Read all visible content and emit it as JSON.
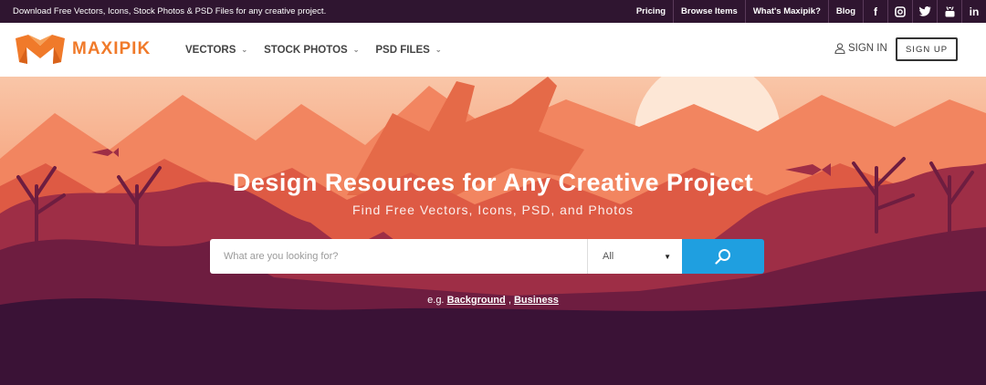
{
  "topbar": {
    "tagline": "Download Free Vectors, Icons, Stock Photos & PSD Files for any creative project.",
    "links": [
      "Pricing",
      "Browse Items",
      "What's Maxipik?",
      "Blog"
    ],
    "social": [
      {
        "name": "facebook-icon",
        "glyph": "f"
      },
      {
        "name": "instagram-icon",
        "glyph": ""
      },
      {
        "name": "twitter-icon",
        "glyph": ""
      },
      {
        "name": "youtube-icon",
        "glyph": ""
      },
      {
        "name": "linkedin-icon",
        "glyph": "in"
      }
    ]
  },
  "header": {
    "logo_text": "MAXIPIK",
    "nav": [
      {
        "label": "VECTORS"
      },
      {
        "label": "STOCK PHOTOS"
      },
      {
        "label": "PSD FILES"
      }
    ],
    "signin_label": "SIGN IN",
    "signup_label": "SIGN UP"
  },
  "hero": {
    "title": "Design Resources for Any Creative Project",
    "subtitle": "Find Free Vectors, Icons, PSD, and Photos",
    "search": {
      "placeholder": "What are you looking for?",
      "value": "",
      "category": "All"
    },
    "examples_prefix": "e.g.",
    "examples": [
      "Background",
      "Business"
    ],
    "examples_sep": ","
  },
  "colors": {
    "brand": "#f07a2a",
    "topbar": "#2f1530",
    "search_button": "#1f9fe0",
    "hero_dark": "#3a1236"
  }
}
